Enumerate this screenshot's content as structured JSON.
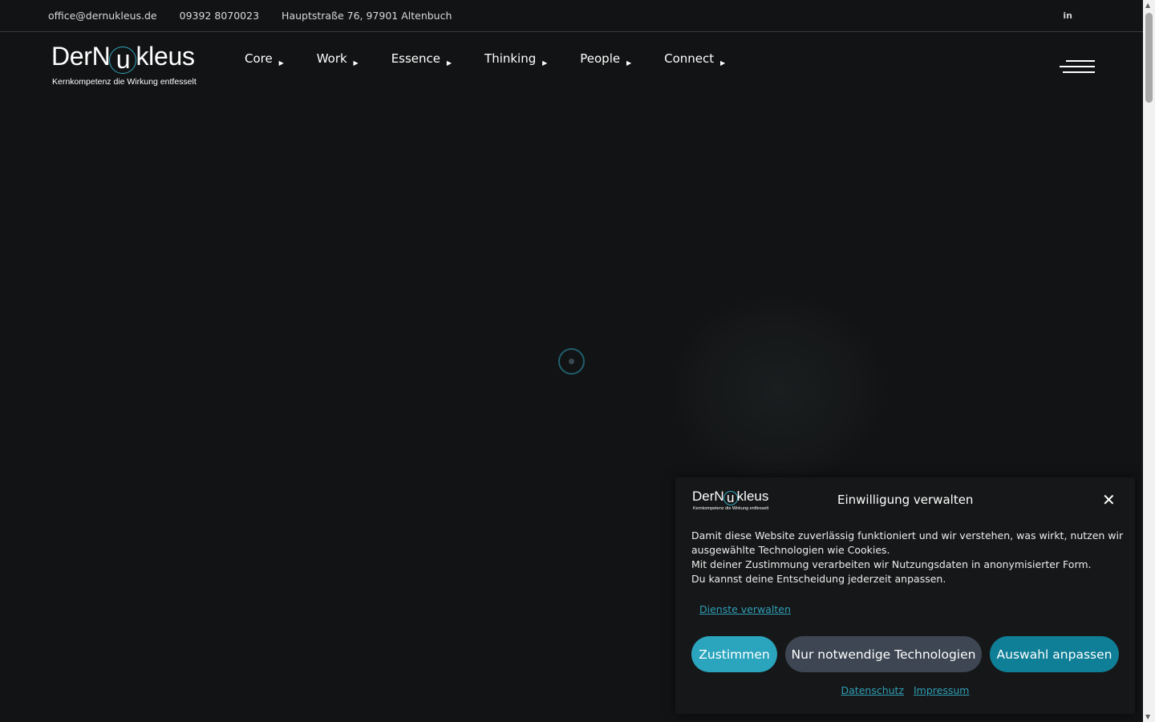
{
  "topbar": {
    "email": "office@dernukleus.de",
    "phone": "09392 8070023",
    "address": "Hauptstraße 76, 97901 Altenbuch",
    "social": "in"
  },
  "header": {
    "logo": {
      "word_start": "DerN",
      "word_ring": "u",
      "word_end": "kleus",
      "tagline": "Kernkompetenz die Wirkung entfesselt"
    },
    "nav": [
      {
        "label": "Core"
      },
      {
        "label": "Work"
      },
      {
        "label": "Essence"
      },
      {
        "label": "Thinking"
      },
      {
        "label": "People"
      },
      {
        "label": "Connect"
      }
    ],
    "caret": "▶"
  },
  "cookie": {
    "title": "Einwilligung verwalten",
    "close": "✕",
    "text": [
      "Damit diese Website zuverlässig funktioniert und wir verstehen, was wirkt, nutzen wir",
      "ausgewählte Technologien wie Cookies.",
      "Mit deiner Zustimmung verarbeiten wir Nutzungsdaten in anonymisierter Form.",
      "Du kannst deine Entscheidung jederzeit anpassen."
    ],
    "manage_link": "Dienste verwalten",
    "buttons": {
      "accept": "Zustimmen",
      "necessary": "Nur notwendige Technologien",
      "customize": "Auswahl anpassen"
    },
    "links": {
      "privacy": "Datenschutz",
      "imprint": "Impressum"
    }
  },
  "scrollbar": {
    "up": "▲",
    "down": "▼"
  },
  "colors": {
    "background": "#121314",
    "accent": "#2aa5bd",
    "accent_dark": "#0f7f97",
    "secondary_button": "#3d4652"
  }
}
